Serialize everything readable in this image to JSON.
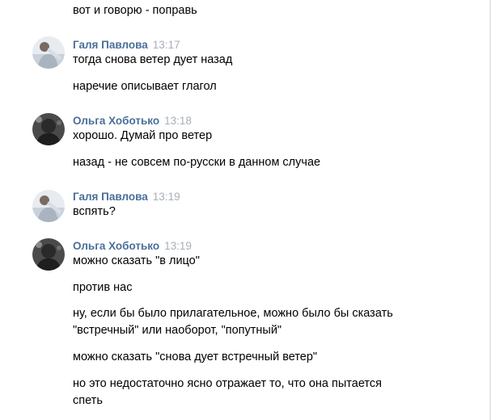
{
  "messages": [
    {
      "text": "вот и говорю - поправь"
    },
    {
      "author": "Галя Павлова",
      "time": "13:17",
      "text": "тогда снова ветер дует назад"
    },
    {
      "text": "наречие описывает глагол"
    },
    {
      "author": "Ольга Хоботько",
      "time": "13:18",
      "text": "хорошо. Думай про ветер"
    },
    {
      "text": "назад - не совсем по-русски в данном случае"
    },
    {
      "author": "Галя Павлова",
      "time": "13:19",
      "text": "вспять?"
    },
    {
      "author": "Ольга Хоботько",
      "time": "13:19",
      "text": "можно сказать \"в лицо\""
    },
    {
      "text": "против нас"
    },
    {
      "text_line1": "ну, если бы было прилагательное, можно было бы сказать",
      "text_line2": "\"встречный\" или наоборот, \"попутный\""
    },
    {
      "text": "можно сказать \"снова дует встречный ветер\""
    },
    {
      "text_line1": "но это недостаточно ясно отражает то, что она пытается",
      "text_line2": "спеть"
    }
  ],
  "colors": {
    "author_name": "#4a6f99",
    "timestamp": "#a8b0b8",
    "text": "#000000",
    "background": "#ffffff"
  },
  "icons": {
    "galya_avatar": "user-photo-light",
    "olga_avatar": "user-photo-dark"
  }
}
